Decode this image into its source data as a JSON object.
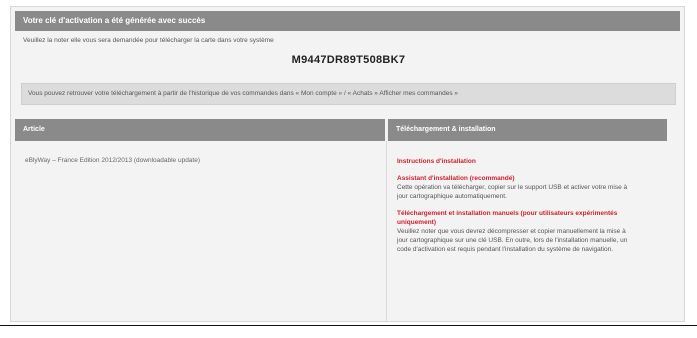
{
  "banner": {
    "title": "Votre clé d'activation a été générée avec succès"
  },
  "notice": "Veuillez la noter elle vous sera demandée pour télécharger la carte dans votre système",
  "activation_code": "M9447DR89T508BK7",
  "info_bar": "Vous pouvez retrouver votre téléchargement à partir de l'historique de vos commandes dans « Mon compte » / « Achats » Afficher mes commandes »",
  "table": {
    "col_article": "Article",
    "col_download": "Téléchargement & installation",
    "article_name": "eBlyWay – France Edition 2012/2013 (downloadable update)",
    "instructions_link": "Instructions d'installation",
    "assistant": {
      "title": "Assistant d'installation (recommandé)",
      "text": "Cette opération va télécharger, copier sur le support USB et activer votre mise à jour cartographique automatiquement."
    },
    "manual": {
      "title": "Téléchargement et installation manuels (pour utilisateurs expérimentés uniquement)",
      "text": "Veuillez noter que vous devrez décompresser et copier manuellement la mise à jour cartographique sur une clé USB. En outre, lors de l'installation manuelle, un code d'activation est requis pendant l'installation du système de navigation."
    }
  }
}
